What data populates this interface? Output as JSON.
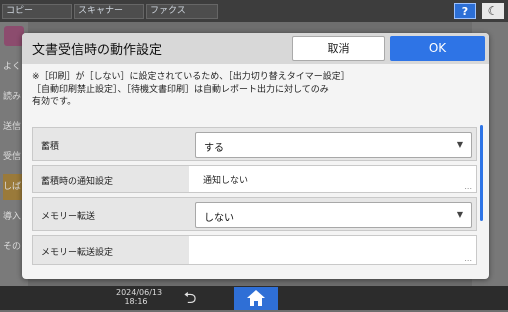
{
  "top_tabs": [
    "コピー",
    "スキャナー",
    "ファクス"
  ],
  "help_label": "?",
  "moon_icon": "crescent-moon-icon",
  "background_side": [
    "よく",
    "読み",
    "送信",
    "受信",
    "しば",
    "導入",
    "その"
  ],
  "dialog": {
    "title": "文書受信時の動作設定",
    "cancel_label": "取消",
    "ok_label": "OK",
    "notice_lines": [
      "※［印刷］が［しない］に設定されているため、［出力切り替えタイマー設定］",
      "［自動印刷禁止設定］、［待機文書印刷］は自動レポート出力に対してのみ",
      "有効です。"
    ],
    "settings": [
      {
        "label": "蓄積",
        "value": "する",
        "type": "dropdown"
      },
      {
        "label": "蓄積時の通知設定",
        "value": "通知しない",
        "type": "detail"
      },
      {
        "label": "メモリー転送",
        "value": "しない",
        "type": "dropdown"
      },
      {
        "label": "メモリー転送設定",
        "value": "",
        "type": "detail"
      }
    ]
  },
  "status": {
    "date": "2024/06/13",
    "time": "18:16"
  },
  "colors": {
    "accent": "#2e74e6",
    "header": "#d8d8d8"
  }
}
